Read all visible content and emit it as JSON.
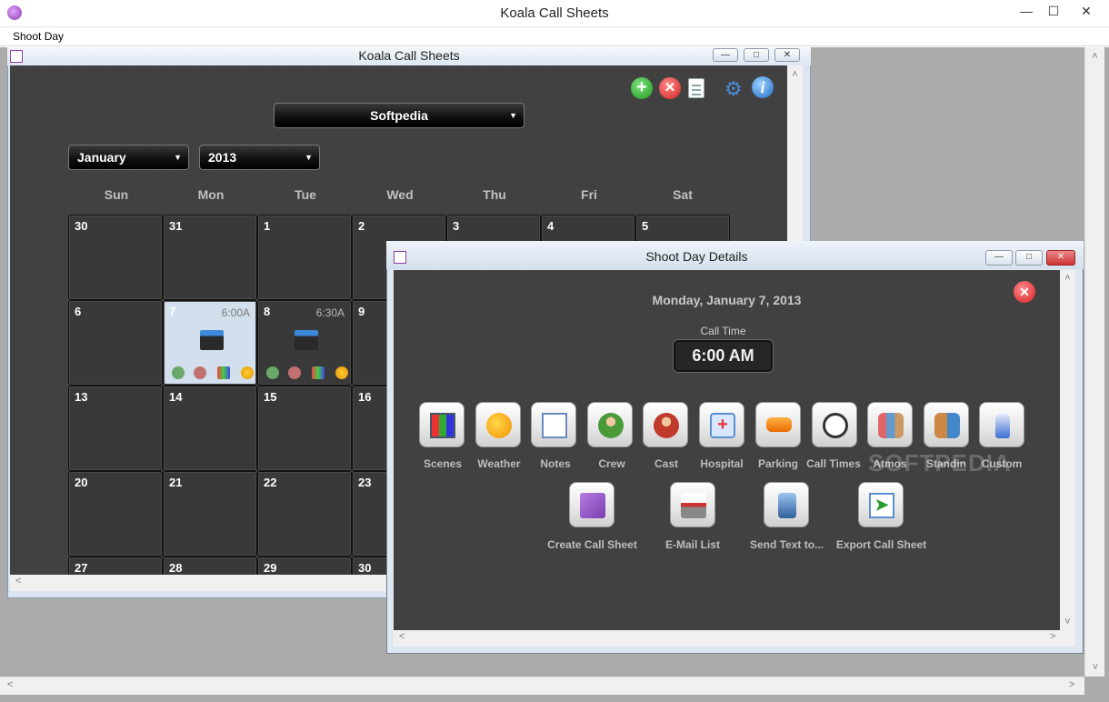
{
  "app": {
    "title": "Koala Call Sheets",
    "menu": [
      "Shoot Day"
    ]
  },
  "calendar_window": {
    "title": "Koala Call Sheets",
    "project_select": "Softpedia",
    "month_select": "January",
    "year_select": "2013",
    "day_names": [
      "Sun",
      "Mon",
      "Tue",
      "Wed",
      "Thu",
      "Fri",
      "Sat"
    ],
    "weeks": [
      [
        "30",
        "31",
        "1",
        "2",
        "3",
        "4",
        "5"
      ],
      [
        "6",
        "7",
        "8",
        "9"
      ],
      [
        "13",
        "14",
        "15",
        "16"
      ],
      [
        "20",
        "21",
        "22",
        "23"
      ],
      [
        "27",
        "28",
        "29",
        "30"
      ]
    ],
    "events": {
      "day7_time": "6:00A",
      "day8_time": "6:30A"
    },
    "toolbar_icons": [
      "add-icon",
      "delete-icon",
      "document-icon",
      "settings-icon",
      "info-icon"
    ]
  },
  "shoot_day_window": {
    "title": "Shoot Day Details",
    "date": "Monday, January 7, 2013",
    "call_time_label": "Call Time",
    "call_time": "6:00 AM",
    "tiles_row1": [
      "Scenes",
      "Weather",
      "Notes",
      "Crew",
      "Cast",
      "Hospital",
      "Parking",
      "Call Times",
      "Atmos",
      "Standin",
      "Custom"
    ],
    "tiles_row2": [
      "Create Call Sheet",
      "E-Mail List",
      "Send Text to...",
      "Export Call Sheet"
    ]
  },
  "watermark": "SOFTPEDIA",
  "colors": {
    "panel_bg": "#414141",
    "selected_day": "#d4dfee",
    "add_green": "#2dab2d",
    "delete_red": "#e53a3a"
  }
}
